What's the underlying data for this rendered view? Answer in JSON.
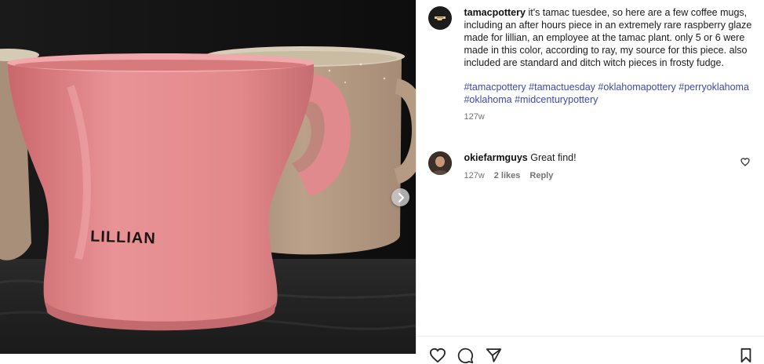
{
  "post": {
    "username": "tamacpottery",
    "caption": "it's tamac tuesdee, so here are a few coffee mugs, including an after hours piece in an extremely rare raspberry glaze made for lillian, an employee at the tamac plant. only 5 or 6 were made in this color, according to ray, my source for this piece. also included are standard and ditch witch pieces in frosty fudge.",
    "hashtags": [
      "#tamacpottery",
      "#tamactuesday",
      "#oklahomapottery",
      "#perryoklahoma",
      "#oklahoma",
      "#midcenturypottery"
    ],
    "age": "127w"
  },
  "comments": [
    {
      "username": "okiefarmguys",
      "text": "Great find!",
      "age": "127w",
      "likes": "2 likes",
      "reply_label": "Reply"
    }
  ],
  "photo": {
    "mug_text": "LILLIAN"
  },
  "icons": {
    "next": "chevron-right-icon",
    "like": "heart-icon",
    "comment": "comment-icon",
    "share": "send-icon",
    "save": "bookmark-icon"
  },
  "colors": {
    "hashtag": "#3d4aa8",
    "mug_pink": "#e48b8d",
    "mug_tan": "#b79d84"
  }
}
